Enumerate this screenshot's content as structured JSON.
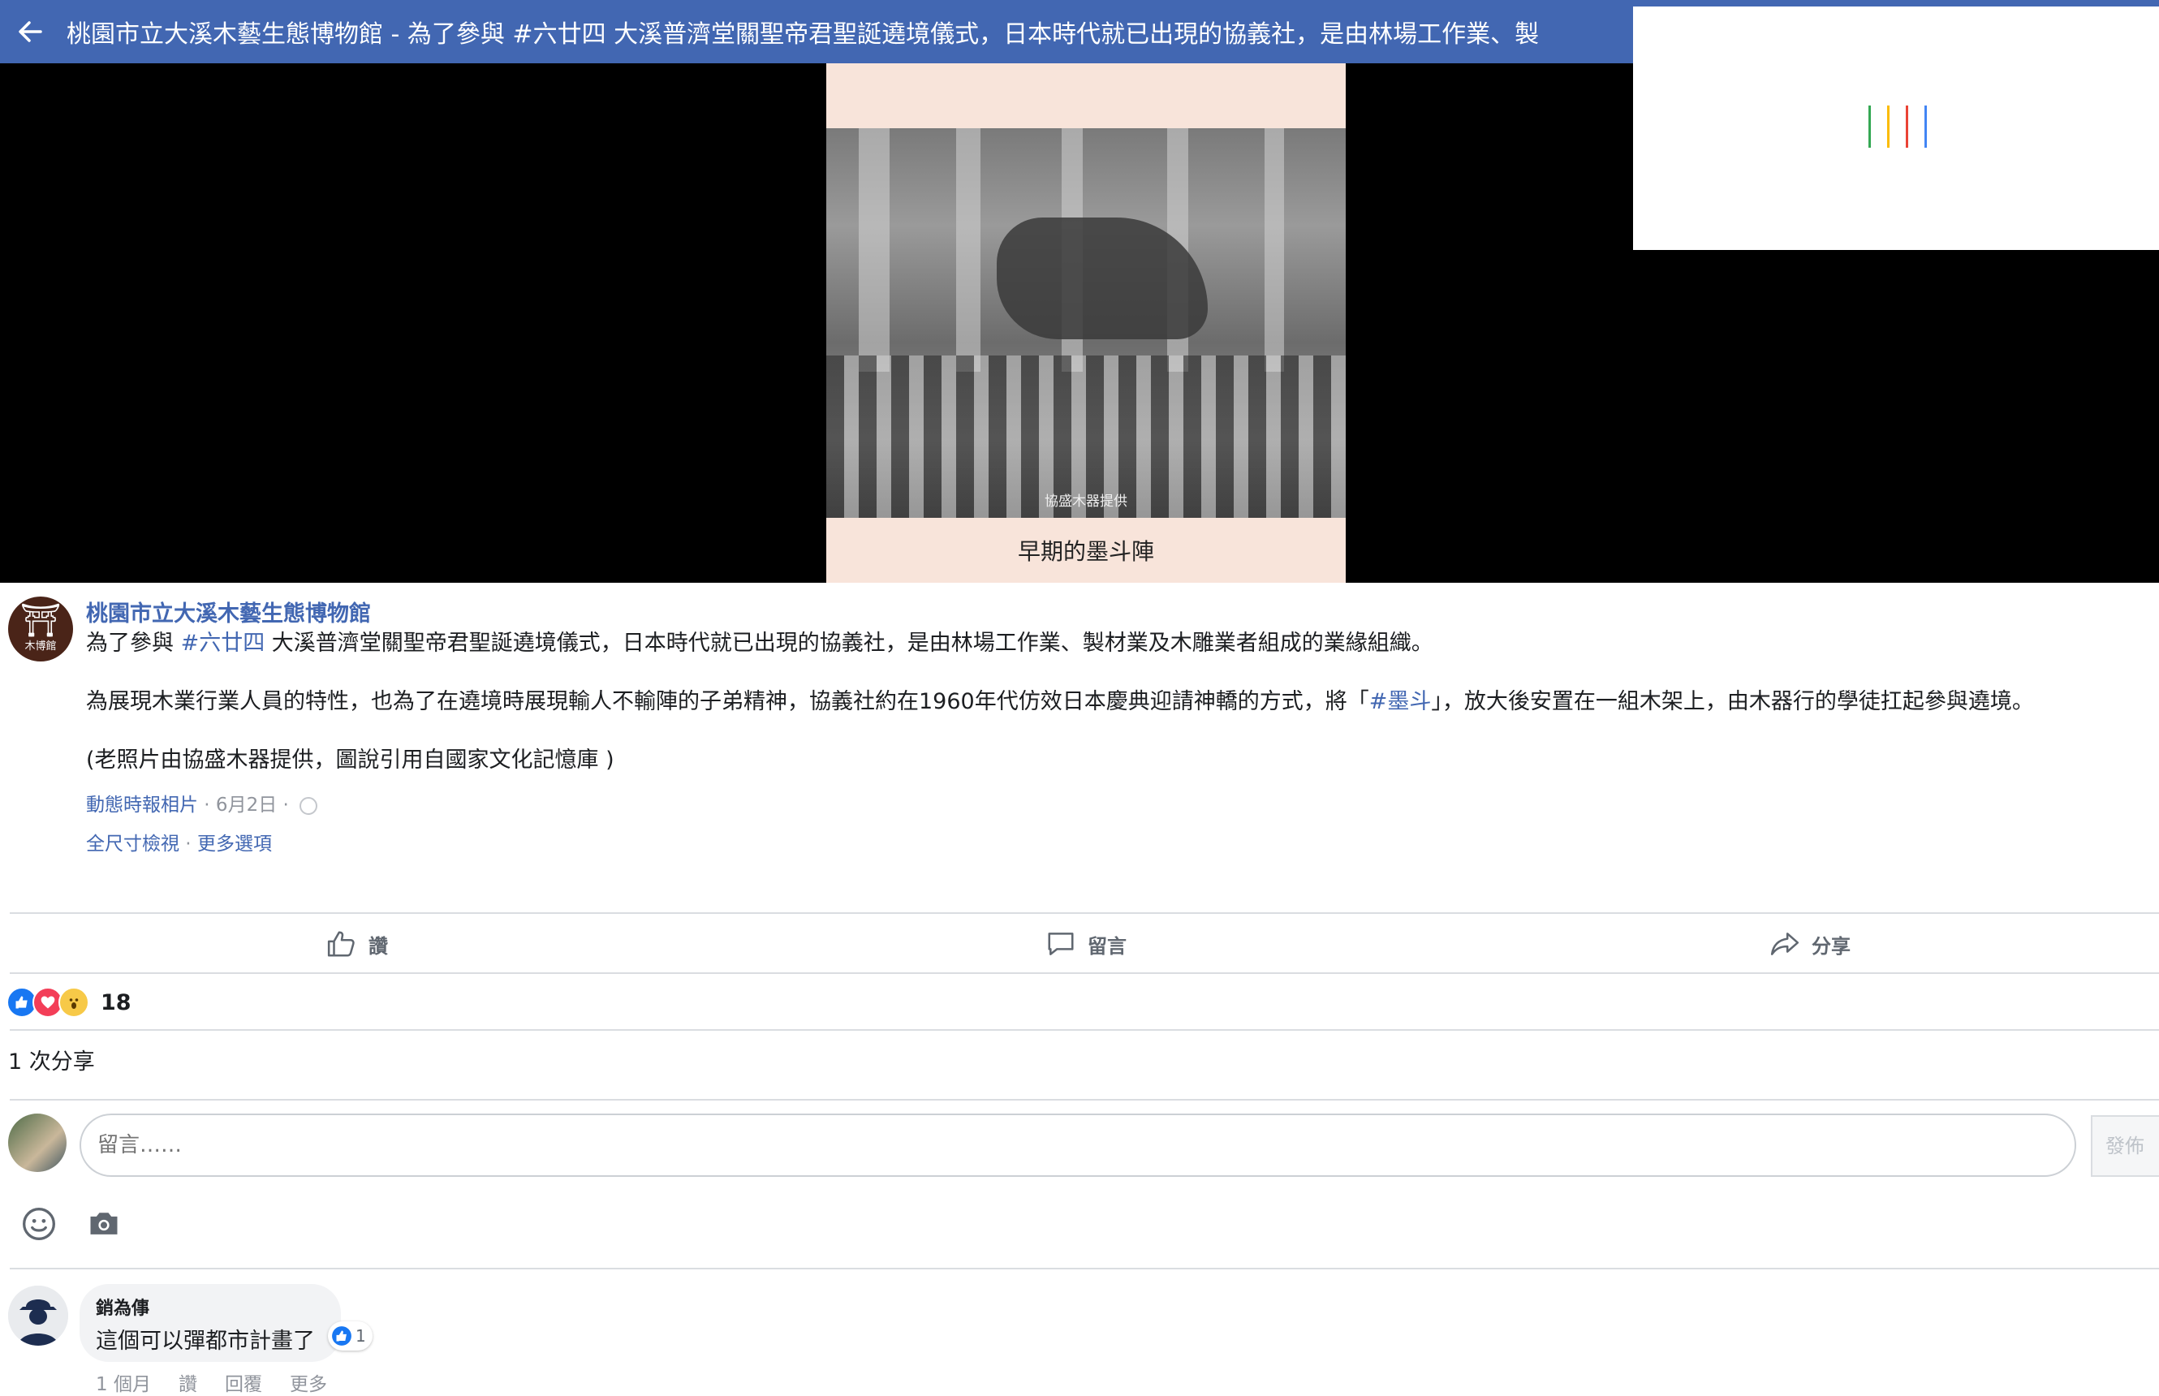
{
  "header": {
    "title": "桃園市立大溪木藝生態博物館 - 為了參與 #六廿四 大溪普濟堂關聖帝君聖誕遶境儀式，日本時代就已出現的協義社，是由林場工作業、製"
  },
  "photo": {
    "credit": "協盛木器提供",
    "caption": "早期的墨斗陣"
  },
  "loader": {
    "bar_colors": [
      "#34a853",
      "#fbbc05",
      "#ea4335",
      "#4285f4"
    ]
  },
  "post": {
    "page_name": "桃園市立大溪木藝生態博物館",
    "avatar_text": "木博館",
    "line1_pre": "為了參與 ",
    "line1_hashtag": "#六廿四",
    "line1_post": " 大溪普濟堂關聖帝君聖誕遶境儀式，日本時代就已出現的協義社，是由林場工作業、製材業及木雕業者組成的業緣組織。",
    "line2_pre": "為展現木業行業人員的特性，也為了在遶境時展現輸人不輸陣的子弟精神，協義社約在1960年代仿效日本慶典迎請神轎的方式，將「",
    "line2_hashtag": "#墨斗",
    "line2_post": "」，放大後安置在一組木架上，由木器行的學徒扛起參與遶境。",
    "line3": "(老照片由協盛木器提供，圖說引用自國家文化記憶庫 )",
    "meta_album": "動態時報相片",
    "meta_date": " · 6月2日 · ",
    "full_size": "全尺寸檢視",
    "separator": " · ",
    "more_options": "更多選項"
  },
  "actions": {
    "like": "讚",
    "comment": "留言",
    "share": "分享"
  },
  "reactions": {
    "count": "18",
    "types": [
      "like",
      "love",
      "wow"
    ]
  },
  "shares": {
    "text": "1 次分享"
  },
  "composer": {
    "placeholder": "留言……",
    "post_button": "發佈"
  },
  "comments": [
    {
      "author": "銷為倳",
      "text": "這個可以彈都市計畫了",
      "like_count": "1",
      "time": "1 個月",
      "like_label": "讚",
      "reply_label": "回覆",
      "more_label": "更多"
    }
  ],
  "colors": {
    "brand_blue": "#4267b2",
    "link_blue": "#4267b2",
    "meta_gray": "#90949c"
  }
}
